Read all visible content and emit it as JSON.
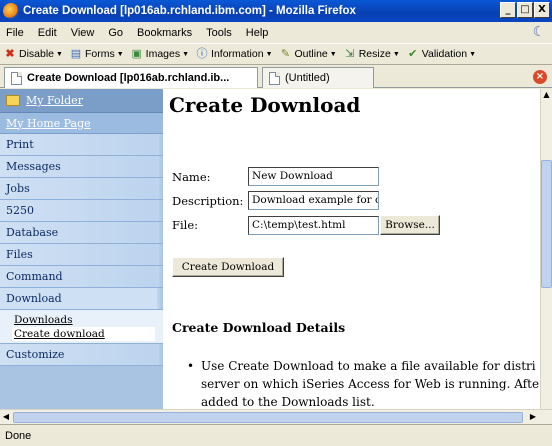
{
  "window": {
    "title": "Create Download [lp016ab.rchland.ibm.com] - Mozilla Firefox",
    "minimize": "_",
    "maximize": "□",
    "close": "X"
  },
  "menu": [
    "File",
    "Edit",
    "View",
    "Go",
    "Bookmarks",
    "Tools",
    "Help"
  ],
  "devtoolbar": [
    "Disable",
    "Forms",
    "Images",
    "Information",
    "Outline",
    "Resize",
    "Validation"
  ],
  "tabs": {
    "active": "Create Download [lp016ab.rchland.ib...",
    "inactive": "(Untitled)"
  },
  "sidebar": {
    "folder": "My Folder",
    "home": "My Home Page",
    "items": [
      "Print",
      "Messages",
      "Jobs",
      "5250",
      "Database",
      "Files",
      "Command",
      "Download"
    ],
    "subitems": [
      "Downloads",
      "Create download"
    ],
    "after": "Customize"
  },
  "page": {
    "title": "Create Download",
    "name_label": "Name:",
    "name_value": "New Download",
    "description_label": "Description:",
    "description_value": "Download example for c",
    "file_label": "File:",
    "file_value": "C:\\temp\\test.html",
    "browse_button": "Browse...",
    "create_button": "Create Download",
    "details_heading": "Create Download Details",
    "bullet_lines": [
      "Use Create Download to make a file available for distri",
      "server on which iSeries Access for Web is running. Afte",
      "added to the Downloads list."
    ]
  },
  "status": "Done"
}
